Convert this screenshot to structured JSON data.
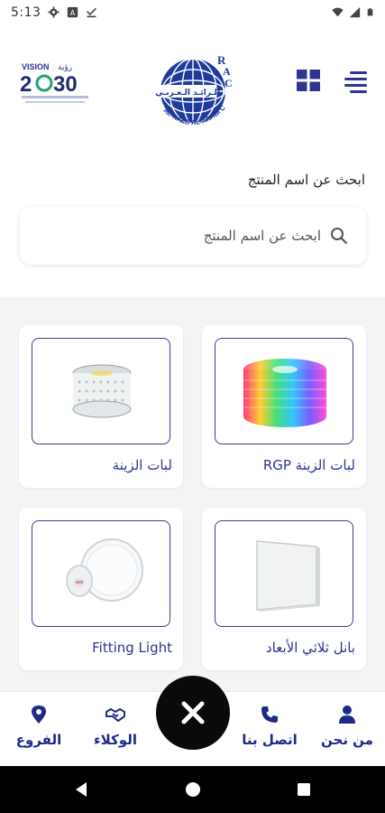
{
  "status_bar": {
    "time": "5:13",
    "left_icons": [
      "gear-icon",
      "a-box-icon",
      "check-download-icon"
    ],
    "right_icons": [
      "wifi-icon",
      "signal-icon",
      "battery-icon"
    ]
  },
  "header": {
    "logo_name": "Al-Raed Al-Arabi Co. logo",
    "vision_logo": "Vision 2030 logo",
    "grid_icon": "grid-icon",
    "menu_icon": "menu-icon"
  },
  "search": {
    "title": "ابحث عن اسم المنتج",
    "placeholder": "ابحث عن اسم المنتج"
  },
  "products": [
    {
      "label": "لبات الزينة RGP",
      "image": "rgb-led-strip"
    },
    {
      "label": "لبات الزينة",
      "image": "white-led-strip"
    },
    {
      "label": "بانل ثلاثي الأبعاد",
      "image": "square-panel"
    },
    {
      "label": "Fitting Light",
      "image": "round-fitting-light"
    }
  ],
  "bottom_nav": {
    "items": [
      {
        "label": "من نحن",
        "icon": "person-icon"
      },
      {
        "label": "اتصل بنا",
        "icon": "phone-icon"
      },
      {
        "label": "الوكلاء",
        "icon": "handshake-icon"
      },
      {
        "label": "الفروع",
        "icon": "location-pin-icon"
      }
    ],
    "fab_icon": "close-icon"
  },
  "colors": {
    "brand_blue": "#2e3590",
    "nav_blue": "#1e2a8a",
    "background": "#f4f4f6"
  }
}
